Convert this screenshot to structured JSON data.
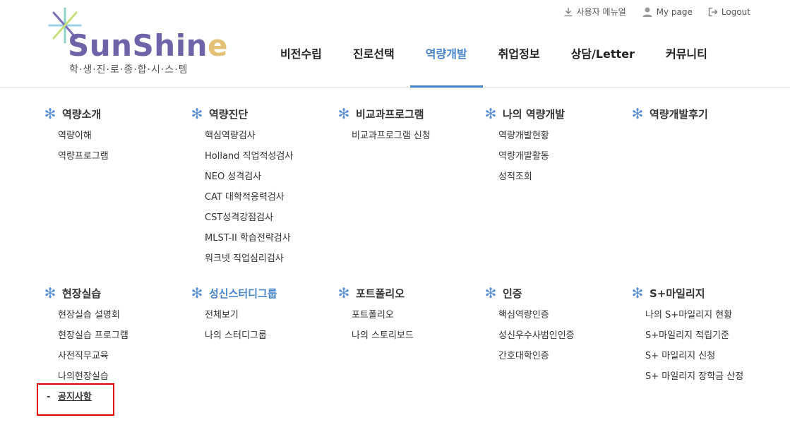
{
  "logo": {
    "word_part1": "SunShin",
    "word_part2": "e",
    "subtitle": "학·생·진·로·종·합·시·스·템"
  },
  "util": [
    {
      "label": "사용자 메뉴얼",
      "icon": "download-icon"
    },
    {
      "label": "My page",
      "icon": "user-icon"
    },
    {
      "label": "Logout",
      "icon": "logout-icon"
    }
  ],
  "gnb": [
    "비전수립",
    "진로선택",
    "역량개발",
    "취업정보",
    "상담/Letter",
    "커뮤니티"
  ],
  "gnb_active_index": 2,
  "accent_color": "#4a84c9",
  "menu": {
    "row1": [
      {
        "title": "역량소개",
        "items": [
          "역량이해",
          "역량프로그램"
        ]
      },
      {
        "title": "역량진단",
        "items": [
          "핵심역량검사",
          "Holland 직업적성검사",
          "NEO 성격검사",
          "CAT 대학적응력검사",
          "CST성격강점검사",
          "MLST-II 학습전략검사",
          "워크넷 직업심리검사"
        ]
      },
      {
        "title": "비교과프로그램",
        "items": [
          "비교과프로그램 신청"
        ]
      },
      {
        "title": "나의 역량개발",
        "items": [
          "역량개발현황",
          "역량개발활동",
          "성적조회"
        ]
      },
      {
        "title": "역량개발후기",
        "items": []
      }
    ],
    "row2": [
      {
        "title": "현장실습",
        "items": [
          "현장실습 설명회",
          "현장실습 프로그램",
          "사전직무교육",
          "나의현장실습",
          "공지사항"
        ]
      },
      {
        "title": "성신스터디그룹",
        "items": [
          "전체보기",
          "나의 스터디그룹"
        ]
      },
      {
        "title": "포트폴리오",
        "items": [
          "포트폴리오",
          "나의 스토리보드"
        ]
      },
      {
        "title": "인증",
        "items": [
          "핵심역량인증",
          "성신우수사범인인증",
          "간호대학인증"
        ]
      },
      {
        "title": "S+마일리지",
        "items": [
          "나의 S+마일리지 현황",
          "S+마일리지 적립기준",
          "S+ 마일리지 신청",
          "S+ 마일리지 장학금 산정"
        ]
      }
    ]
  }
}
